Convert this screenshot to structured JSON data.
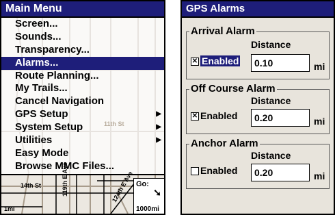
{
  "main_menu": {
    "title": "Main Menu",
    "items": [
      {
        "label": "Screen..."
      },
      {
        "label": "Sounds..."
      },
      {
        "label": "Transparency..."
      },
      {
        "label": "Alarms...",
        "selected": true
      },
      {
        "label": "Route Planning..."
      },
      {
        "label": "My Trails..."
      },
      {
        "label": "Cancel Navigation"
      },
      {
        "label": "GPS Setup",
        "has_submenu": true
      },
      {
        "label": "System Setup",
        "has_submenu": true
      },
      {
        "label": "Utilities",
        "has_submenu": true
      },
      {
        "label": "Easy Mode"
      },
      {
        "label": "Browse MMC Files..."
      }
    ],
    "map_labels": {
      "street_14th": "14th St",
      "street_11th": "11th St",
      "ave_119th": "119th E Ave",
      "ave_124th": "124th E Ave",
      "scale": "1mi"
    },
    "go_box": {
      "label": "Go:",
      "distance": "1000mi",
      "icon": "heading-arrow-icon"
    }
  },
  "gps_alarms": {
    "title": "GPS Alarms",
    "arrival": {
      "title": "Arrival Alarm",
      "distance_label": "Distance",
      "enabled_label": "Enabled",
      "enabled": true,
      "value": "0.10",
      "unit": "mi"
    },
    "off_course": {
      "title": "Off Course Alarm",
      "distance_label": "Distance",
      "enabled_label": "Enabled",
      "enabled": true,
      "value": "0.20",
      "unit": "mi"
    },
    "anchor": {
      "title": "Anchor Alarm",
      "distance_label": "Distance",
      "enabled_label": "Enabled",
      "enabled": false,
      "value": "0.20",
      "unit": "mi"
    }
  },
  "colors": {
    "header": "#1e1e7a",
    "panel": "#e8e4dc",
    "map_road": "#a89c8c"
  }
}
